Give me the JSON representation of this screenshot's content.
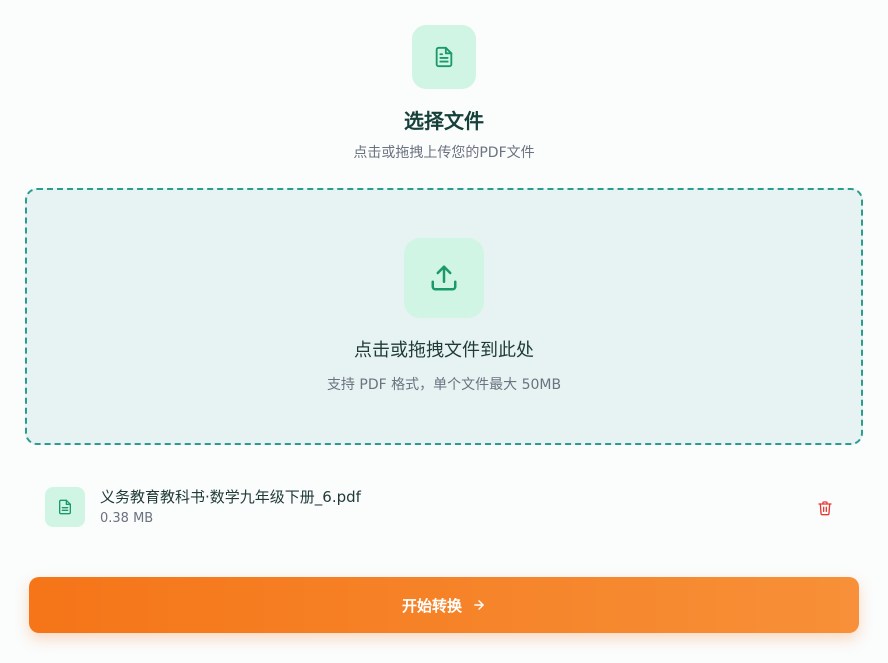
{
  "header": {
    "icon": "document-icon",
    "title": "选择文件",
    "subtitle": "点击或拖拽上传您的PDF文件"
  },
  "dropzone": {
    "icon": "upload-icon",
    "title": "点击或拖拽文件到此处",
    "hint": "支持 PDF 格式，单个文件最大 50MB"
  },
  "files": [
    {
      "icon": "file-icon",
      "name": "义务教育教科书·数学九年级下册_6.pdf",
      "size": "0.38 MB",
      "delete_icon": "trash-icon"
    }
  ],
  "actions": {
    "start_label": "开始转换",
    "start_icon": "arrow-right-icon"
  },
  "colors": {
    "accent": "#1a9a6c",
    "accent_bg": "#d1f5e4",
    "dropzone_border": "#2a9d8f",
    "dropzone_bg": "#e7f3f2",
    "button_start": "#f57518",
    "button_end": "#f79038",
    "danger": "#e53935"
  }
}
